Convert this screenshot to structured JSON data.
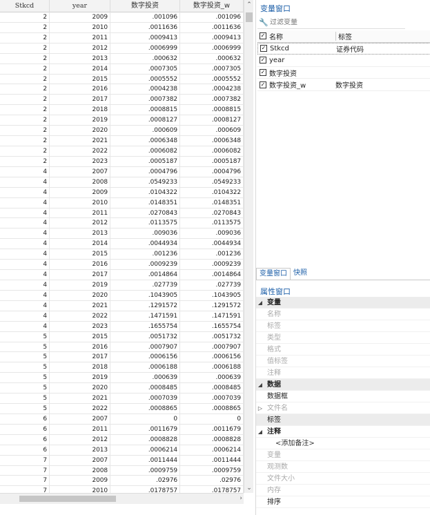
{
  "grid": {
    "columns": [
      "Stkcd",
      "year",
      "数字投资",
      "数字投资_w"
    ],
    "rows": [
      [
        "2",
        "2009",
        ".001096",
        ".001096"
      ],
      [
        "2",
        "2010",
        ".0011636",
        ".0011636"
      ],
      [
        "2",
        "2011",
        ".0009413",
        ".0009413"
      ],
      [
        "2",
        "2012",
        ".0006999",
        ".0006999"
      ],
      [
        "2",
        "2013",
        ".000632",
        ".000632"
      ],
      [
        "2",
        "2014",
        ".0007305",
        ".0007305"
      ],
      [
        "2",
        "2015",
        ".0005552",
        ".0005552"
      ],
      [
        "2",
        "2016",
        ".0004238",
        ".0004238"
      ],
      [
        "2",
        "2017",
        ".0007382",
        ".0007382"
      ],
      [
        "2",
        "2018",
        ".0008815",
        ".0008815"
      ],
      [
        "2",
        "2019",
        ".0008127",
        ".0008127"
      ],
      [
        "2",
        "2020",
        ".000609",
        ".000609"
      ],
      [
        "2",
        "2021",
        ".0006348",
        ".0006348"
      ],
      [
        "2",
        "2022",
        ".0006082",
        ".0006082"
      ],
      [
        "2",
        "2023",
        ".0005187",
        ".0005187"
      ],
      [
        "4",
        "2007",
        ".0004796",
        ".0004796"
      ],
      [
        "4",
        "2008",
        ".0549233",
        ".0549233"
      ],
      [
        "4",
        "2009",
        ".0104322",
        ".0104322"
      ],
      [
        "4",
        "2010",
        ".0148351",
        ".0148351"
      ],
      [
        "4",
        "2011",
        ".0270843",
        ".0270843"
      ],
      [
        "4",
        "2012",
        ".0113575",
        ".0113575"
      ],
      [
        "4",
        "2013",
        ".009036",
        ".009036"
      ],
      [
        "4",
        "2014",
        ".0044934",
        ".0044934"
      ],
      [
        "4",
        "2015",
        ".001236",
        ".001236"
      ],
      [
        "4",
        "2016",
        ".0009239",
        ".0009239"
      ],
      [
        "4",
        "2017",
        ".0014864",
        ".0014864"
      ],
      [
        "4",
        "2019",
        ".027739",
        ".027739"
      ],
      [
        "4",
        "2020",
        ".1043905",
        ".1043905"
      ],
      [
        "4",
        "2021",
        ".1291572",
        ".1291572"
      ],
      [
        "4",
        "2022",
        ".1471591",
        ".1471591"
      ],
      [
        "4",
        "2023",
        ".1655754",
        ".1655754"
      ],
      [
        "5",
        "2015",
        ".0051732",
        ".0051732"
      ],
      [
        "5",
        "2016",
        ".0007907",
        ".0007907"
      ],
      [
        "5",
        "2017",
        ".0006156",
        ".0006156"
      ],
      [
        "5",
        "2018",
        ".0006188",
        ".0006188"
      ],
      [
        "5",
        "2019",
        ".000639",
        ".000639"
      ],
      [
        "5",
        "2020",
        ".0008485",
        ".0008485"
      ],
      [
        "5",
        "2021",
        ".0007039",
        ".0007039"
      ],
      [
        "5",
        "2022",
        ".0008865",
        ".0008865"
      ],
      [
        "6",
        "2007",
        "0",
        "0"
      ],
      [
        "6",
        "2011",
        ".0011679",
        ".0011679"
      ],
      [
        "6",
        "2012",
        ".0008828",
        ".0008828"
      ],
      [
        "6",
        "2013",
        ".0006214",
        ".0006214"
      ],
      [
        "7",
        "2007",
        ".0011444",
        ".0011444"
      ],
      [
        "7",
        "2008",
        ".0009759",
        ".0009759"
      ],
      [
        "7",
        "2009",
        ".02976",
        ".02976"
      ],
      [
        "7",
        "2010",
        ".0178757",
        ".0178757"
      ],
      [
        "7",
        "2011",
        ".0114559",
        ".0114559"
      ]
    ]
  },
  "variables_panel": {
    "title": "变量窗口",
    "filter_placeholder": "过滤变量",
    "header": {
      "name": "名称",
      "label": "标签"
    },
    "items": [
      {
        "name": "Stkcd",
        "label": "证券代码",
        "checked": true
      },
      {
        "name": "year",
        "label": "",
        "checked": true
      },
      {
        "name": "数字投资",
        "label": "",
        "checked": true
      },
      {
        "name": "数字投资_w",
        "label": "数字投资",
        "checked": true
      }
    ]
  },
  "tabs": [
    "变量窗口",
    "快照"
  ],
  "properties_panel": {
    "title": "属性窗口",
    "rows": [
      {
        "type": "group",
        "label": "变量",
        "arrow": "◢"
      },
      {
        "type": "item",
        "label": "名称"
      },
      {
        "type": "item",
        "label": "标签"
      },
      {
        "type": "item",
        "label": "类型"
      },
      {
        "type": "item",
        "label": "格式"
      },
      {
        "type": "item",
        "label": "值标签"
      },
      {
        "type": "item",
        "label": "注释"
      },
      {
        "type": "group",
        "label": "数据",
        "arrow": "◢"
      },
      {
        "type": "dark",
        "label": "数据框"
      },
      {
        "type": "item",
        "label": "文件名",
        "arrow": "▷"
      },
      {
        "type": "gapdark",
        "label": "标签"
      },
      {
        "type": "darkgroup",
        "label": "注释",
        "arrow": "◢"
      },
      {
        "type": "note",
        "label": "<添加备注>"
      },
      {
        "type": "item",
        "label": "变量"
      },
      {
        "type": "item",
        "label": "观测数"
      },
      {
        "type": "item",
        "label": "文件大小"
      },
      {
        "type": "item",
        "label": "内存"
      },
      {
        "type": "dark",
        "label": "排序"
      }
    ]
  },
  "icons": {
    "filter": "wrench-icon",
    "checkbox": "check-icon"
  }
}
